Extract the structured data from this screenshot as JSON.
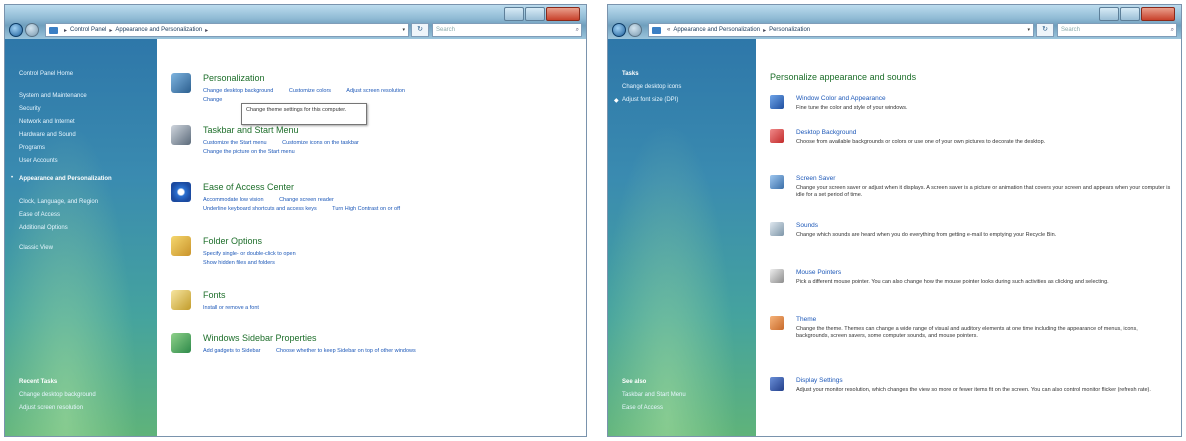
{
  "left_window": {
    "address": {
      "root": "Control Panel",
      "current": "Appearance and Personalization"
    },
    "search_placeholder": "Search",
    "sidebar": {
      "items": [
        "Control Panel Home",
        "System and Maintenance",
        "Security",
        "Network and Internet",
        "Hardware and Sound",
        "Programs",
        "User Accounts",
        "Appearance and Personalization",
        "Clock, Language, and Region",
        "Ease of Access",
        "Additional Options",
        "Classic View"
      ],
      "recent_heading": "Recent Tasks",
      "recent": [
        "Change desktop background",
        "Adjust screen resolution"
      ]
    },
    "categories": [
      {
        "title": "Personalization",
        "links": [
          "Change desktop background",
          "Customize colors",
          "Adjust screen resolution"
        ],
        "links2": [
          "Change"
        ]
      },
      {
        "title": "Taskbar and Start Menu",
        "links": [
          "Customize the Start menu",
          "Customize icons on the taskbar"
        ],
        "links2": [
          "Change the picture on the Start menu"
        ]
      },
      {
        "title": "Ease of Access Center",
        "links": [
          "Accommodate low vision",
          "Change screen reader"
        ],
        "links2": [
          "Underline keyboard shortcuts and access keys",
          "Turn High Contrast on or off"
        ]
      },
      {
        "title": "Folder Options",
        "links": [
          "Specify single- or double-click to open",
          "Show hidden files and folders"
        ],
        "links2": []
      },
      {
        "title": "Fonts",
        "links": [
          "Install or remove a font"
        ],
        "links2": []
      },
      {
        "title": "Windows Sidebar Properties",
        "links": [
          "Add gadgets to Sidebar",
          "Choose whether to keep Sidebar on top of other windows"
        ],
        "links2": []
      }
    ],
    "tooltip": "Change theme settings for this computer."
  },
  "right_window": {
    "address": {
      "parent": "Appearance and Personalization",
      "current": "Personalization"
    },
    "search_placeholder": "Search",
    "sidebar": {
      "tasks_heading": "Tasks",
      "tasks": [
        "Change desktop icons",
        "Adjust font size (DPI)"
      ],
      "see_also_heading": "See also",
      "see_also": [
        "Taskbar and Start Menu",
        "Ease of Access"
      ]
    },
    "heading": "Personalize appearance and sounds",
    "tasks": [
      {
        "title": "Window Color and Appearance",
        "desc": "Fine tune the color and style of your windows."
      },
      {
        "title": "Desktop Background",
        "desc": "Choose from available backgrounds or colors or use one of your own pictures to decorate the desktop."
      },
      {
        "title": "Screen Saver",
        "desc": "Change your screen saver or adjust when it displays. A screen saver is a picture or animation that covers your screen and appears when your computer is idle for a set period of time."
      },
      {
        "title": "Sounds",
        "desc": "Change which sounds are heard when you do everything from getting e-mail to emptying your Recycle Bin."
      },
      {
        "title": "Mouse Pointers",
        "desc": "Pick a different mouse pointer. You can also change how the mouse pointer looks during such activities as clicking and selecting."
      },
      {
        "title": "Theme",
        "desc": "Change the theme. Themes can change a wide range of visual and auditory elements at one time including the appearance of menus, icons, backgrounds, screen savers, some computer sounds, and mouse pointers."
      },
      {
        "title": "Display Settings",
        "desc": "Adjust your monitor resolution, which changes the view so more or fewer items fit on the screen. You can also control monitor flicker (refresh rate)."
      }
    ]
  }
}
